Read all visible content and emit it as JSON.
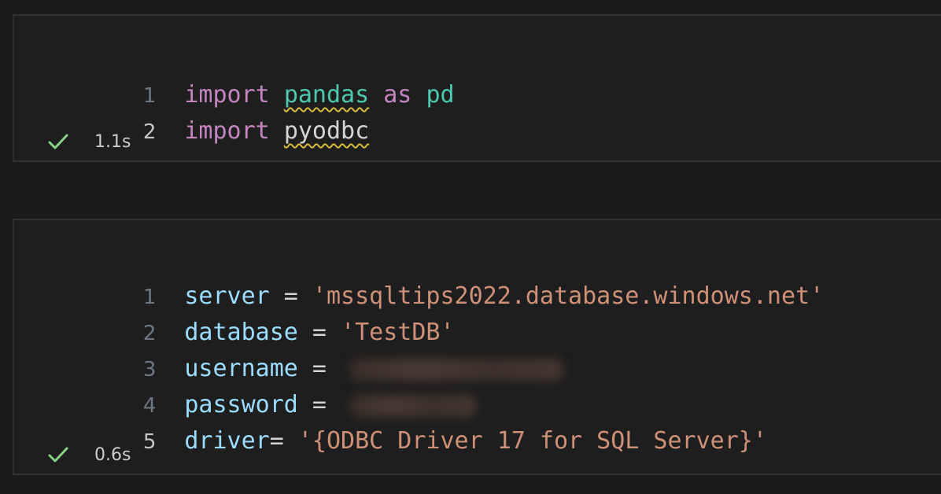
{
  "cells": [
    {
      "execution_time": "1.1s",
      "status_icon": "check-icon",
      "lines": [
        {
          "number": "1",
          "kw1": "import",
          "module": "pandas",
          "kw2": "as",
          "alias": "pd"
        },
        {
          "number": "2",
          "kw1": "import",
          "module": "pyodbc"
        }
      ]
    },
    {
      "execution_time": "0.6s",
      "status_icon": "check-icon",
      "lines": [
        {
          "number": "1",
          "var": "server",
          "op": " = ",
          "value": "'mssqltips2022.database.windows.net'"
        },
        {
          "number": "2",
          "var": "database",
          "op": " = ",
          "value": "'TestDB'"
        },
        {
          "number": "3",
          "var": "username",
          "op": " = ",
          "value": ""
        },
        {
          "number": "4",
          "var": "password",
          "op": " = ",
          "value": ""
        },
        {
          "number": "5",
          "var": "driver",
          "op": "= ",
          "value": "'{ODBC Driver 17 for SQL Server}'"
        }
      ]
    }
  ],
  "colors": {
    "keyword": "#c586c0",
    "module": "#4ec9b0",
    "variable": "#9cdcfe",
    "string": "#ce9178",
    "success": "#89d185"
  }
}
